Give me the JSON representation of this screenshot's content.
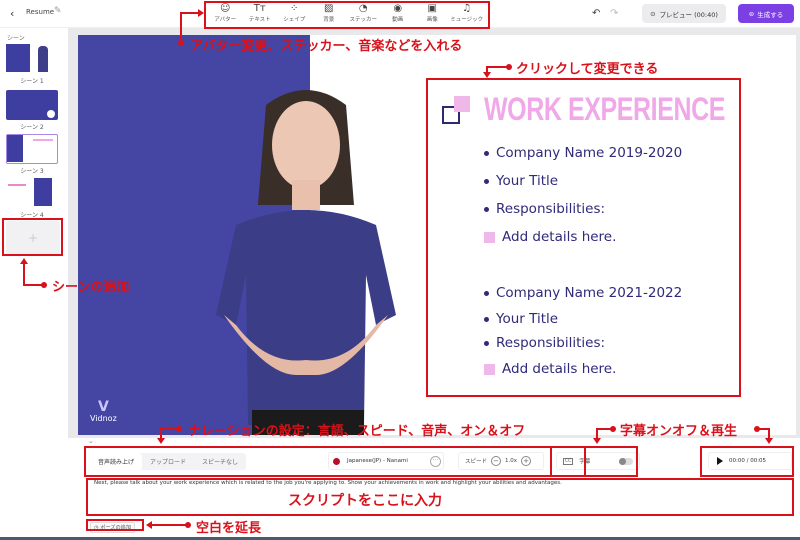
{
  "header": {
    "project_title": "Resume",
    "tools": [
      {
        "icon": "avatar-icon",
        "glyph": "☺",
        "label": "アバター"
      },
      {
        "icon": "text-icon",
        "glyph": "Tт",
        "label": "テキスト"
      },
      {
        "icon": "shape-icon",
        "glyph": "⁘",
        "label": "シェイプ"
      },
      {
        "icon": "background-icon",
        "glyph": "▨",
        "label": "背景"
      },
      {
        "icon": "sticker-icon",
        "glyph": "◔",
        "label": "ステッカー"
      },
      {
        "icon": "video-icon",
        "glyph": "◉",
        "label": "動画"
      },
      {
        "icon": "image-icon",
        "glyph": "▣",
        "label": "画像"
      },
      {
        "icon": "music-icon",
        "glyph": "♫",
        "label": "ミュージック"
      }
    ],
    "preview_label": "プレビュー (00:40)",
    "generate_label": "生成する"
  },
  "sidebar": {
    "title": "シーン",
    "scenes": [
      {
        "label": "シーン 1",
        "selected": false
      },
      {
        "label": "シーン 2",
        "selected": false
      },
      {
        "label": "シーン 3",
        "selected": true
      },
      {
        "label": "シーン 4",
        "selected": false
      }
    ],
    "add_symbol": "+"
  },
  "slide": {
    "title": "WORK EXPERIENCE",
    "group1": [
      {
        "marker": "dot",
        "text": "Company Name 2019-2020"
      },
      {
        "marker": "dot",
        "text": "Your Title"
      },
      {
        "marker": "dot",
        "text": "Responsibilities:"
      },
      {
        "marker": "square",
        "text": "Add details here."
      }
    ],
    "group2": [
      {
        "marker": "dot",
        "text": "Company Name 2021-2022"
      },
      {
        "marker": "dot",
        "text": "Your Title"
      },
      {
        "marker": "dot",
        "text": "Responsibilities:"
      },
      {
        "marker": "square",
        "text": "Add details here."
      }
    ],
    "watermark": "Vidnoz",
    "colors": {
      "left_panel": "#4545a4",
      "title": "#f0a8e8",
      "text": "#2f2a7a"
    }
  },
  "narration": {
    "tabs": [
      {
        "label": "音声読み上げ",
        "active": true
      },
      {
        "label": "アップロード",
        "active": false
      },
      {
        "label": "スピーチなし",
        "active": false
      }
    ],
    "voice": "Japanese(JP) - Nanami",
    "speed_label": "スピード",
    "speed_value": "1.0x",
    "subtitle_label": "字幕",
    "subtitle_on": false,
    "time": "00:00 / 00:05",
    "script": "Next, please talk about your work experience which is related to the job you're applying to. Show your achievements in work and highlight your abilities and advantages.",
    "pause_label": "ポーズの追加"
  },
  "annotations": {
    "toolbar": "アバター変更、ステッカー、音楽などを入れる",
    "slide": "クリックして変更できる",
    "add_scene": "シーンの追加",
    "narration": "ナレーションの設定：言語、スピード、音声、オン＆オフ",
    "subtitle_play": "字幕オンオフ＆再生",
    "script": "スクリプトをここに入力",
    "pause": "空白を延長"
  }
}
